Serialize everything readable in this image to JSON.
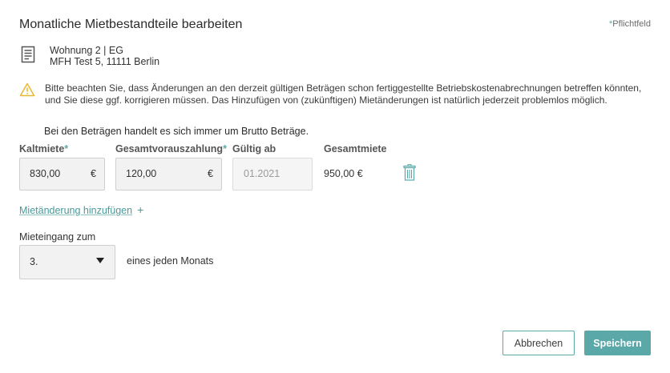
{
  "dialog": {
    "title": "Monatliche Mietbestandteile bearbeiten",
    "required_star": "*",
    "required_label": "Pflichtfeld"
  },
  "property": {
    "icon": "document-icon",
    "unit": "Wohnung 2 | EG",
    "address": "MFH Test 5, 11111 Berlin"
  },
  "notice": {
    "icon": "warning-icon",
    "text": "Bitte beachten Sie, dass Änderungen an den derzeit gültigen Beträgen schon fertiggestellte Betriebskostenabrechnungen betreffen könnten, und Sie diese ggf. korrigieren müssen. Das Hinzufügen von (zukünftigen) Mietänderungen ist natürlich jederzeit problemlos möglich.",
    "brutto": "Bei den Beträgen handelt es sich immer um Brutto Beträge."
  },
  "rent": {
    "kaltmiete": {
      "label": "Kaltmiete",
      "star": "*",
      "value": "830,00",
      "currency": "€"
    },
    "vorauszahlung": {
      "label": "Gesamtvorauszahlung",
      "star": "*",
      "value": "120,00",
      "currency": "€"
    },
    "gueltig_ab": {
      "label": "Gültig ab",
      "value": "01.2021"
    },
    "gesamtmiete": {
      "label": "Gesamtmiete",
      "value": "950,00 €"
    },
    "delete_icon": "trash-icon"
  },
  "add_change": {
    "label": "Mietänderung hinzufügen",
    "icon": "plus-icon",
    "symbol": "+"
  },
  "payment": {
    "label": "Mieteingang zum",
    "selected": "3.",
    "suffix": "eines jeden Monats"
  },
  "buttons": {
    "cancel": "Abbrechen",
    "save": "Speichern"
  },
  "colors": {
    "accent": "#5ba8a8",
    "warning": "#e8b82e"
  }
}
